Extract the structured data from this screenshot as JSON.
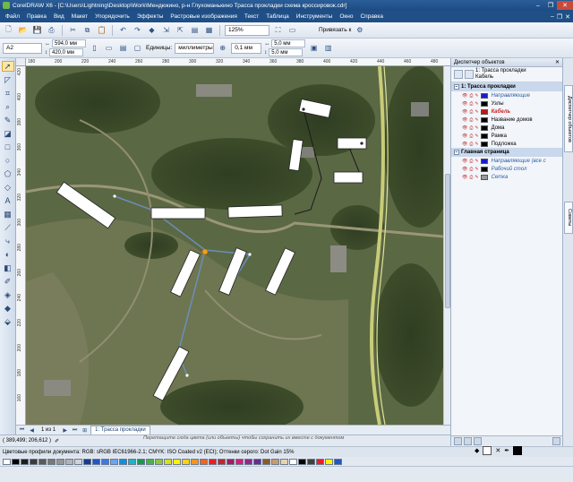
{
  "window": {
    "title": "CorelDRAW X6 - [C:\\Users\\Lightning\\Desktop\\Work\\Мендюкино, р-н Глухоманькино Трасса прокладки схема кроссировок.cdr]",
    "minimize": "–",
    "maximize": "❐",
    "close": "✕"
  },
  "menu": [
    "Файл",
    "Правка",
    "Вид",
    "Макет",
    "Упорядочить",
    "Эффекты",
    "Растровые изображения",
    "Текст",
    "Таблица",
    "Инструменты",
    "Окно",
    "Справка"
  ],
  "toolbar": {
    "zoom_value": "125%",
    "snap_label": "Привязать к"
  },
  "propbar": {
    "paper_size": "A2",
    "width": "594,0 мм",
    "height": "420,0 мм",
    "units_label": "Единицы:",
    "units_value": "миллиметры",
    "nudge": "0,1 мм",
    "dup_x": "5,0 мм",
    "dup_y": "5,0 мм"
  },
  "rulers": {
    "top": [
      "180",
      "200",
      "220",
      "240",
      "260",
      "280",
      "300",
      "320",
      "340",
      "360",
      "380",
      "400",
      "420",
      "440",
      "460",
      "480"
    ],
    "left": [
      "420",
      "400",
      "380",
      "360",
      "340",
      "320",
      "300",
      "280",
      "260",
      "240",
      "220",
      "200",
      "180",
      "160"
    ]
  },
  "pagebar": {
    "page_count": "1 из 1",
    "page_tab": "1: Трасса прокладки"
  },
  "hint": "Перетащите сюда цвета (или объекты) чтобы сохранить их вместе с документом",
  "status": {
    "coords": "( 389,499; 206,612 )"
  },
  "profiles": "Цветовые профили документа: RGB: sRGB IEC61966-2.1; CMYK: ISO Coated v2 (ECI); Оттенки серого: Dot Gain 15%",
  "docker": {
    "title": "Диспетчер объектов",
    "close": "✕",
    "current_page": "1: Трасса прокладки",
    "current_layer": "Кабель",
    "page1_header": "1: Трасса прокладки",
    "layers": [
      {
        "name": "Направляющие",
        "style": "blue",
        "color": "#1a1acc"
      },
      {
        "name": "Узлы",
        "style": "normal",
        "color": "#000000"
      },
      {
        "name": "Кабель",
        "style": "red",
        "color": "#cc1111"
      },
      {
        "name": "Название домов",
        "style": "normal",
        "color": "#000000"
      },
      {
        "name": "Дома",
        "style": "normal",
        "color": "#000000"
      },
      {
        "name": "Рамка",
        "style": "normal",
        "color": "#000000"
      },
      {
        "name": "Подложка",
        "style": "normal",
        "color": "#000000"
      }
    ],
    "master_header": "Главная страница",
    "master_layers": [
      {
        "name": "Направляющие (все с",
        "style": "blue",
        "color": "#1a1acc"
      },
      {
        "name": "Рабочий стол",
        "style": "blue",
        "color": "#000000"
      },
      {
        "name": "Сетка",
        "style": "blue",
        "color": "#9a9a9a"
      }
    ]
  },
  "side_tabs": [
    "Диспетчер объектов",
    "Советы"
  ],
  "palette_colors": [
    "#ffffff",
    "#000000",
    "#1d1d1d",
    "#3b3b3b",
    "#5a5a5a",
    "#787878",
    "#969696",
    "#b4b4b4",
    "#d2d2d2",
    "#1a3a8a",
    "#2255c5",
    "#3d7be0",
    "#6fa3f0",
    "#168fd2",
    "#18b6c6",
    "#1a9a4a",
    "#45b646",
    "#8cc63f",
    "#d6df22",
    "#fff200",
    "#fcd116",
    "#f7941d",
    "#f26522",
    "#ed1c24",
    "#c1272d",
    "#9e1f63",
    "#d91c7a",
    "#92278f",
    "#662d91",
    "#8a5a2b",
    "#c69c6d",
    "#e7d3b3",
    "#ffffff",
    "#000000",
    "#404040",
    "#ed1c24",
    "#fff200",
    "#2255c5"
  ],
  "colors": {
    "accent": "#1f4f86",
    "cable_line": "#6a8fb8",
    "road": "#d4d68a"
  }
}
